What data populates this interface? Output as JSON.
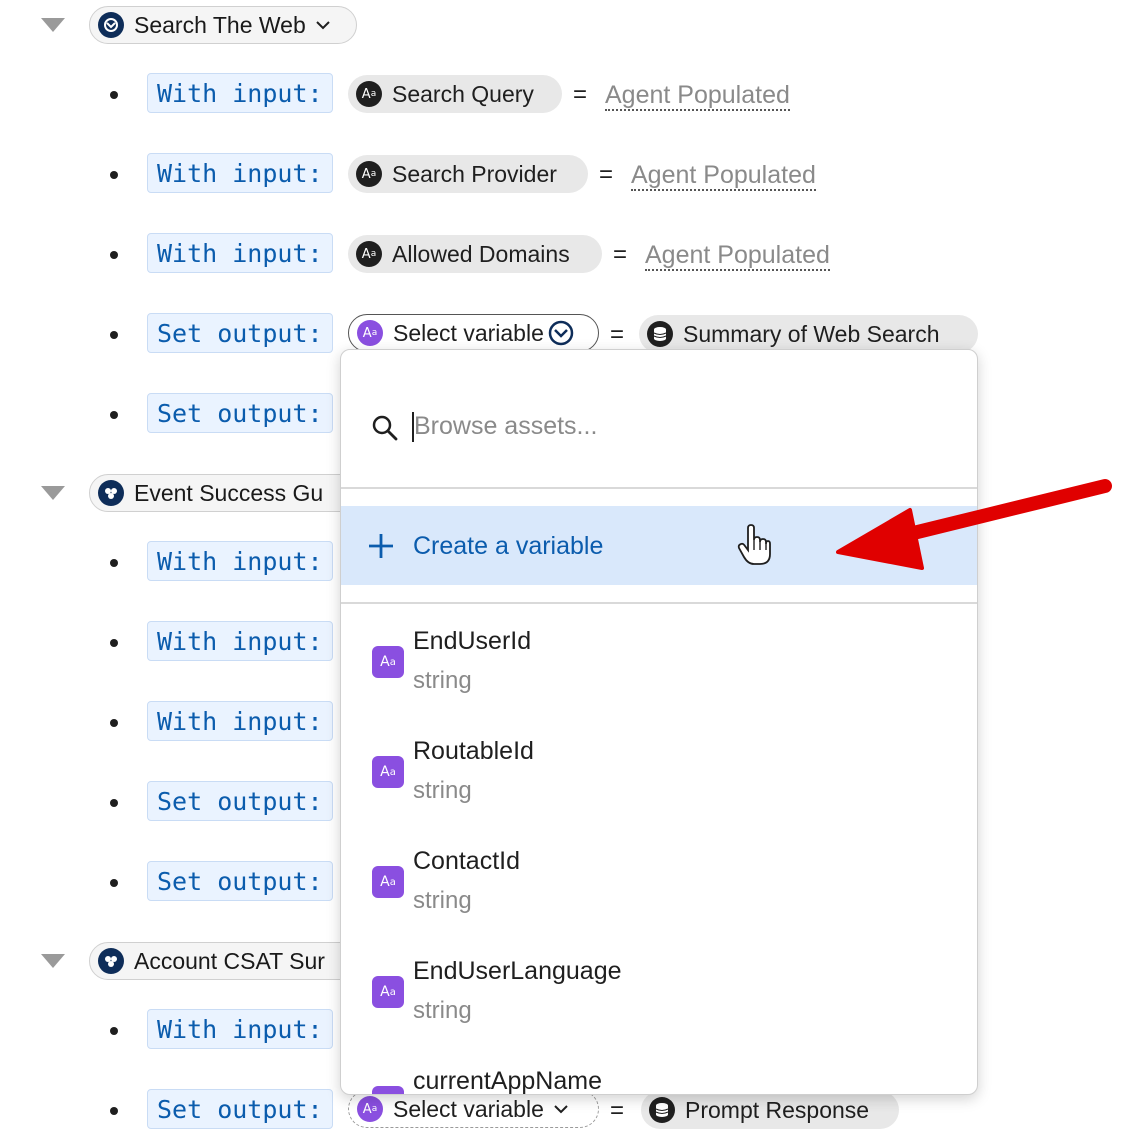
{
  "actions": [
    {
      "name": "Search The Web",
      "rows": [
        {
          "label": "With input:",
          "chip": "Search Query",
          "value": "Agent Populated"
        },
        {
          "label": "With input:",
          "chip": "Search Provider",
          "value": "Agent Populated"
        },
        {
          "label": "With input:",
          "chip": "Allowed Domains",
          "value": "Agent Populated"
        },
        {
          "label": "Set output:",
          "chip": "Select variable",
          "value": "Summary of Web Search"
        },
        {
          "label": "Set output:"
        }
      ]
    },
    {
      "name": "Event Success Gu",
      "rows": [
        {
          "label": "With input:"
        },
        {
          "label": "With input:"
        },
        {
          "label": "With input:"
        },
        {
          "label": "Set output:"
        },
        {
          "label": "Set output:"
        }
      ]
    },
    {
      "name": "Account CSAT Sur",
      "rows": [
        {
          "label": "With input:"
        },
        {
          "label": "Set output:",
          "chip": "Select variable",
          "value": "Prompt Response"
        }
      ]
    }
  ],
  "dropdown": {
    "search_placeholder": "Browse assets...",
    "create_label": "Create a variable",
    "variables": [
      {
        "name": "EndUserId",
        "type": "string"
      },
      {
        "name": "RoutableId",
        "type": "string"
      },
      {
        "name": "ContactId",
        "type": "string"
      },
      {
        "name": "EndUserLanguage",
        "type": "string"
      },
      {
        "name": "currentAppName",
        "type": ""
      }
    ]
  },
  "icons": {
    "action": "agent-action-icon",
    "text_var": "text-variable-icon",
    "db": "database-icon",
    "search": "search-icon",
    "plus": "plus-icon",
    "chevron": "chevron-down-icon",
    "pointer": "hand-pointer-cursor-icon",
    "arrow": "red-annotation-arrow"
  },
  "colors": {
    "accent": "#0b5cad",
    "highlight": "#d9e8fb",
    "variable": "#8a4fe0",
    "annotation": "#e00000"
  }
}
